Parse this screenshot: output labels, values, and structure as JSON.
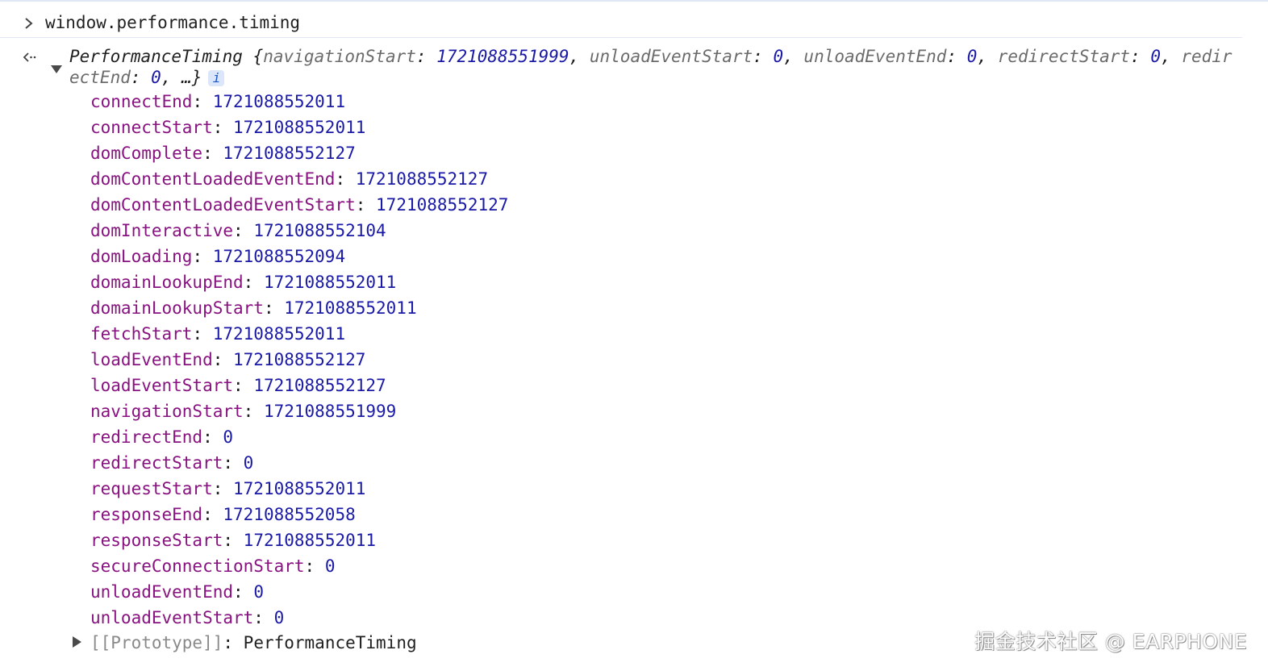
{
  "console": {
    "input": "window.performance.timing",
    "summary": {
      "class_name": "PerformanceTiming",
      "open_brace": "{",
      "items": [
        {
          "key": "navigationStart",
          "value": "1721088551999"
        },
        {
          "key": "unloadEventStart",
          "value": "0"
        },
        {
          "key": "unloadEventEnd",
          "value": "0"
        },
        {
          "key": "redirectStart",
          "value": "0"
        },
        {
          "key": "redirectEnd",
          "value": "0"
        }
      ],
      "ellipsis": "…}",
      "info_badge": "i"
    },
    "properties": [
      {
        "key": "connectEnd",
        "value": "1721088552011"
      },
      {
        "key": "connectStart",
        "value": "1721088552011"
      },
      {
        "key": "domComplete",
        "value": "1721088552127"
      },
      {
        "key": "domContentLoadedEventEnd",
        "value": "1721088552127"
      },
      {
        "key": "domContentLoadedEventStart",
        "value": "1721088552127"
      },
      {
        "key": "domInteractive",
        "value": "1721088552104"
      },
      {
        "key": "domLoading",
        "value": "1721088552094"
      },
      {
        "key": "domainLookupEnd",
        "value": "1721088552011"
      },
      {
        "key": "domainLookupStart",
        "value": "1721088552011"
      },
      {
        "key": "fetchStart",
        "value": "1721088552011"
      },
      {
        "key": "loadEventEnd",
        "value": "1721088552127"
      },
      {
        "key": "loadEventStart",
        "value": "1721088552127"
      },
      {
        "key": "navigationStart",
        "value": "1721088551999"
      },
      {
        "key": "redirectEnd",
        "value": "0"
      },
      {
        "key": "redirectStart",
        "value": "0"
      },
      {
        "key": "requestStart",
        "value": "1721088552011"
      },
      {
        "key": "responseEnd",
        "value": "1721088552058"
      },
      {
        "key": "responseStart",
        "value": "1721088552011"
      },
      {
        "key": "secureConnectionStart",
        "value": "0"
      },
      {
        "key": "unloadEventEnd",
        "value": "0"
      },
      {
        "key": "unloadEventStart",
        "value": "0"
      }
    ],
    "prototype": {
      "key": "[[Prototype]]",
      "value": "PerformanceTiming"
    }
  },
  "watermark": "掘金技术社区 @ EARPHONE",
  "icons": {
    "prompt": "chevron-right-icon",
    "result": "return-arrow-icon",
    "expand": "triangle-down-icon",
    "collapse": "triangle-right-icon"
  },
  "colors": {
    "property_key": "#881280",
    "number_value": "#1a1aa6",
    "summary_key": "#6b6b6b",
    "badge_bg": "#dbe6fb",
    "divider": "#dfe7f5"
  }
}
